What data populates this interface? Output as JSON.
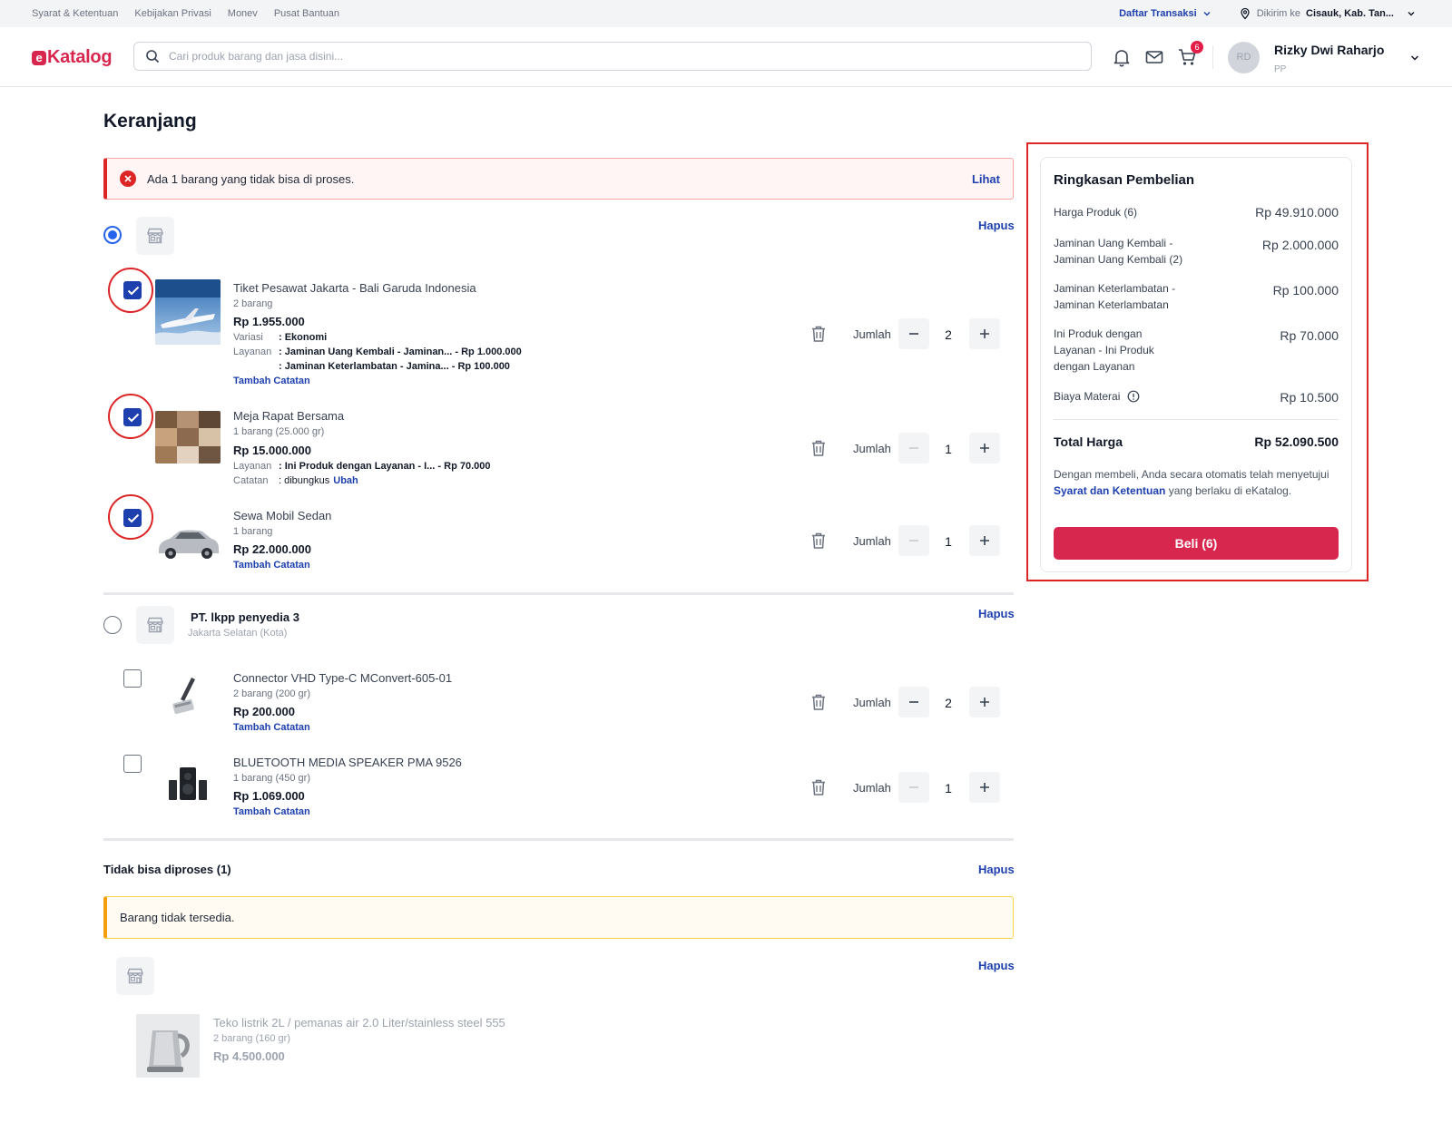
{
  "topbar": {
    "links": [
      "Syarat & Ketentuan",
      "Kebijakan Privasi",
      "Monev",
      "Pusat Bantuan"
    ],
    "transactions_label": "Daftar Transaksi",
    "ship_label": "Dikirim ke",
    "ship_location": "Cisauk, Kab. Tan..."
  },
  "header": {
    "logo_text": "Katalog",
    "logo_mark": "e",
    "search_placeholder": "Cari produk barang dan jasa disini...",
    "cart_count": "6",
    "user_initials": "RD",
    "user_name": "Rizky Dwi Raharjo",
    "user_role": "PP"
  },
  "page": {
    "title": "Keranjang",
    "alert_text": "Ada 1 barang yang tidak bisa di proses.",
    "alert_link": "Lihat",
    "remove_label": "Hapus",
    "qty_label": "Jumlah"
  },
  "store1": {
    "items": [
      {
        "title": "Tiket Pesawat Jakarta - Bali Garuda Indonesia",
        "sub": "2 barang",
        "price": "Rp 1.955.000",
        "variant_key": "Variasi",
        "variant_val": ": Ekonomi",
        "service_key": "Layanan",
        "service_val_1": ": Jaminan Uang Kembali - Jaminan... - Rp 1.000.000",
        "service_val_2": ": Jaminan Keterlambatan - Jamina... - Rp 100.000",
        "note_link": "Tambah Catatan",
        "qty": "2"
      },
      {
        "title": "Meja Rapat Bersama",
        "sub": "1 barang (25.000 gr)",
        "price": "Rp 15.000.000",
        "service_key": "Layanan",
        "service_val": ": Ini Produk dengan Layanan - I... - Rp 70.000",
        "note_key": "Catatan",
        "note_val": ": dibungkus",
        "note_edit": "Ubah",
        "qty": "1"
      },
      {
        "title": "Sewa Mobil Sedan",
        "sub": "1 barang",
        "price": "Rp 22.000.000",
        "note_link": "Tambah Catatan",
        "qty": "1"
      }
    ]
  },
  "store2": {
    "name": "PT. lkpp penyedia 3",
    "location": "Jakarta Selatan (Kota)",
    "items": [
      {
        "title": "Connector VHD Type-C MConvert-605-01",
        "sub": "2 barang (200 gr)",
        "price": "Rp 200.000",
        "note_link": "Tambah Catatan",
        "qty": "2"
      },
      {
        "title": "BLUETOOTH MEDIA SPEAKER PMA 9526",
        "sub": "1 barang (450 gr)",
        "price": "Rp 1.069.000",
        "note_link": "Tambah Catatan",
        "qty": "1"
      }
    ]
  },
  "unprocessable": {
    "title": "Tidak bisa diproses (1)",
    "warning": "Barang tidak tersedia.",
    "item": {
      "title": "Teko listrik 2L / pemanas air 2.0 Liter/stainless steel 555",
      "sub": "2 barang (160 gr)",
      "price": "Rp 4.500.000"
    }
  },
  "summary": {
    "title": "Ringkasan Pembelian",
    "rows": [
      {
        "label": "Harga Produk (6)",
        "value": "Rp 49.910.000"
      },
      {
        "label": "Jaminan Uang Kembali - Jaminan Uang Kembali (2)",
        "value": "Rp 2.000.000"
      },
      {
        "label": "Jaminan Keterlambatan - Jaminan Keterlambatan",
        "value": "Rp 100.000"
      },
      {
        "label": "Ini Produk dengan Layanan - Ini Produk dengan Layanan",
        "value": "Rp 70.000"
      },
      {
        "label": "Biaya Materai",
        "value": "Rp 10.500"
      }
    ],
    "total_label": "Total Harga",
    "total_value": "Rp 52.090.500",
    "terms_pre": "Dengan membeli, Anda secara otomatis telah menyetujui ",
    "terms_link": "Syarat dan Ketentuan",
    "terms_post": " yang berlaku di eKatalog.",
    "buy_label": "Beli (6)"
  },
  "colors": {
    "brand": "#d7274f",
    "link": "#1e40af",
    "checkbox": "#1e3fae",
    "error": "#dc2626",
    "warning": "#f59e0b"
  }
}
